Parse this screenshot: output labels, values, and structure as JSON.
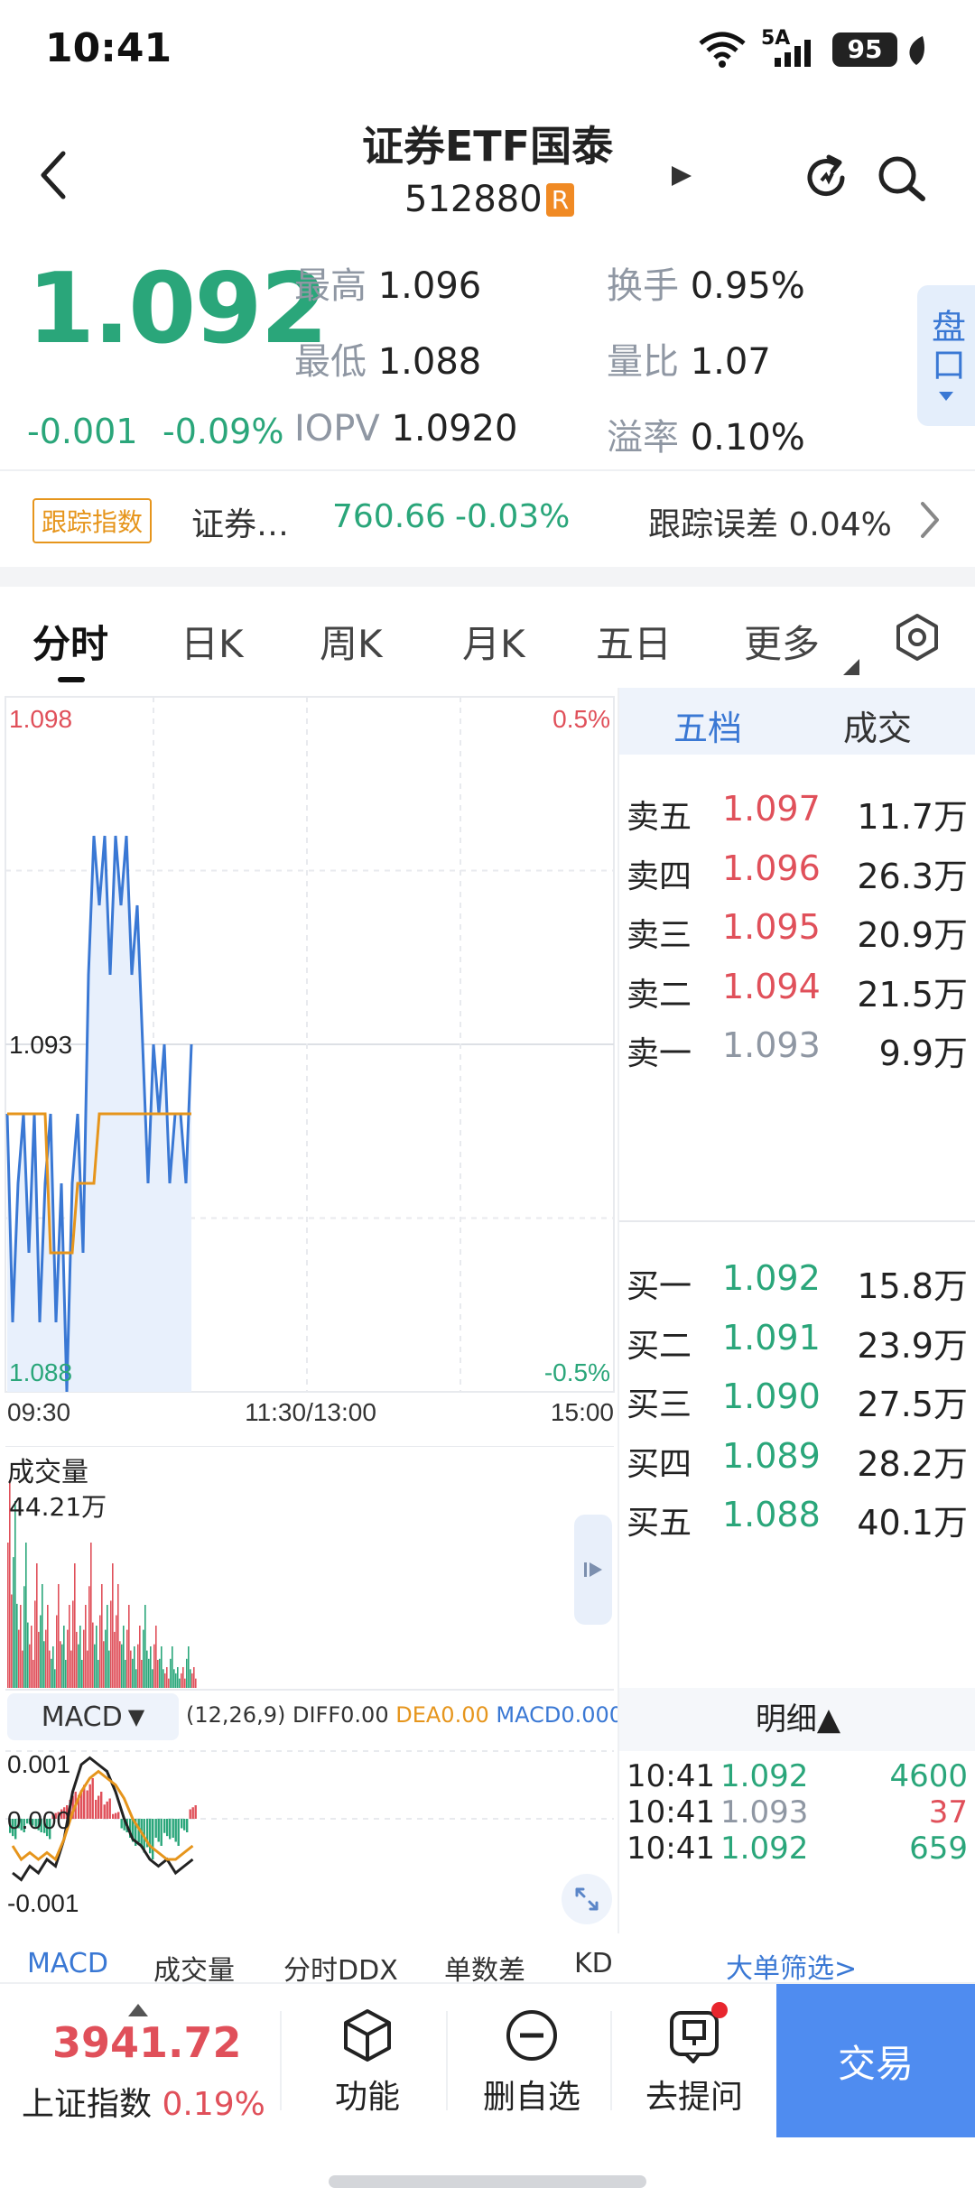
{
  "status_bar": {
    "time": "10:41",
    "net_label": "5A",
    "battery": "95"
  },
  "header": {
    "title": "证券ETF国泰",
    "code": "512880",
    "badge": "R"
  },
  "quote": {
    "price": "1.092",
    "change": "-0.001",
    "change_pct": "-0.09%",
    "high_label": "最高",
    "high": "1.096",
    "low_label": "最低",
    "low": "1.088",
    "iopv_label": "IOPV",
    "iopv": "1.0920",
    "turnover_label": "换手",
    "turnover": "0.95%",
    "vol_ratio_label": "量比",
    "vol_ratio": "1.07",
    "premium_label": "溢率",
    "premium": "0.10%",
    "pankou": "盘口"
  },
  "tracking": {
    "tag": "跟踪指数",
    "name": "证券…",
    "value": "760.66",
    "pct": "-0.03%",
    "error_label": "跟踪误差",
    "error": "0.04%"
  },
  "tabs": [
    {
      "label": "分时",
      "active": true
    },
    {
      "label": "日K",
      "active": false
    },
    {
      "label": "周K",
      "active": false
    },
    {
      "label": "月K",
      "active": false
    },
    {
      "label": "五日",
      "active": false
    },
    {
      "label": "更多",
      "active": false
    }
  ],
  "chart_data": {
    "type": "line",
    "y_max_label": "1.098",
    "y_mid_label": "1.093",
    "y_min_label": "1.088",
    "pct_max_label": "0.5%",
    "pct_min_label": "-0.5%",
    "x_labels": [
      "09:30",
      "11:30/13:00",
      "15:00"
    ],
    "ylim": [
      1.088,
      1.098
    ],
    "price": [
      1.092,
      1.089,
      1.091,
      1.092,
      1.09,
      1.092,
      1.089,
      1.091,
      1.092,
      1.089,
      1.091,
      1.088,
      1.091,
      1.092,
      1.09,
      1.094,
      1.096,
      1.095,
      1.096,
      1.094,
      1.096,
      1.095,
      1.096,
      1.094,
      1.095,
      1.093,
      1.091,
      1.093,
      1.092,
      1.093,
      1.091,
      1.092,
      1.092,
      1.091,
      1.093
    ],
    "avg": [
      1.092,
      1.092,
      1.092,
      1.092,
      1.092,
      1.092,
      1.092,
      1.092,
      1.09,
      1.09,
      1.09,
      1.09,
      1.09,
      1.091,
      1.091,
      1.091,
      1.091,
      1.092,
      1.092,
      1.092,
      1.092,
      1.092,
      1.092,
      1.092,
      1.092,
      1.092,
      1.092,
      1.092,
      1.092,
      1.092,
      1.092,
      1.092,
      1.092,
      1.092,
      1.092
    ],
    "volume_label": "成交量",
    "volume_max_label": "44.21万",
    "volume": [
      10,
      9,
      4,
      7,
      3,
      6,
      5,
      4,
      2,
      5,
      3,
      4,
      6,
      3,
      4,
      7,
      3,
      5,
      4,
      6,
      5,
      3,
      4,
      2,
      3,
      4,
      2,
      3,
      2,
      1,
      2,
      1,
      1,
      2,
      1
    ],
    "volume_up": [
      true,
      false,
      true,
      false,
      true,
      true,
      false,
      true,
      false,
      true,
      false,
      true,
      true,
      false,
      true,
      true,
      false,
      true,
      false,
      true,
      true,
      false,
      true,
      false,
      true,
      false,
      false,
      true,
      false,
      true,
      false,
      false,
      true,
      false,
      true
    ],
    "macd_title": "MACD",
    "macd_params": "(12,26,9)",
    "diff_label": "DIFF0.00",
    "dea_label": "DEA0.00",
    "macd_label": "MACD0.000",
    "macd_axis": [
      "0.001",
      "0.000",
      "-0.001"
    ],
    "macd_diff": [
      -0.0008,
      -0.0009,
      -0.0007,
      -0.0008,
      -0.0006,
      -0.0007,
      -0.0003,
      0.0004,
      0.0008,
      0.0009,
      0.0008,
      0.0007,
      0.0004,
      0.0,
      -0.0003,
      -0.0004,
      -0.0006,
      -0.0007,
      -0.0006,
      -0.0008,
      -0.0007,
      -0.0006
    ],
    "macd_dea": [
      -0.0004,
      -0.0006,
      -0.0005,
      -0.0006,
      -0.0005,
      -0.0006,
      -0.0003,
      0.0001,
      0.0004,
      0.0006,
      0.0007,
      0.0006,
      0.0005,
      0.0003,
      0.0,
      -0.0002,
      -0.0004,
      -0.0005,
      -0.0006,
      -0.0006,
      -0.0005,
      -0.0004
    ],
    "macd_hist": [
      -0.0003,
      -0.0002,
      -0.0001,
      -0.0002,
      -0.0003,
      0.0001,
      0.0002,
      0.0004,
      0.0005,
      0.0006,
      0.0004,
      0.0003,
      0.0001,
      -0.0002,
      -0.0004,
      -0.0005,
      -0.0006,
      -0.0004,
      -0.0003,
      -0.0004,
      -0.0002,
      0.0002
    ]
  },
  "orderbook": {
    "tab_a": "五档",
    "tab_b": "成交",
    "asks": [
      {
        "label": "卖五",
        "price": "1.097",
        "vol": "11.7万"
      },
      {
        "label": "卖四",
        "price": "1.096",
        "vol": "26.3万"
      },
      {
        "label": "卖三",
        "price": "1.095",
        "vol": "20.9万"
      },
      {
        "label": "卖二",
        "price": "1.094",
        "vol": "21.5万"
      },
      {
        "label": "卖一",
        "price": "1.093",
        "vol": "9.9万"
      }
    ],
    "bids": [
      {
        "label": "买一",
        "price": "1.092",
        "vol": "15.8万"
      },
      {
        "label": "买二",
        "price": "1.091",
        "vol": "23.9万"
      },
      {
        "label": "买三",
        "price": "1.090",
        "vol": "27.5万"
      },
      {
        "label": "买四",
        "price": "1.089",
        "vol": "28.2万"
      },
      {
        "label": "买五",
        "price": "1.088",
        "vol": "40.1万"
      }
    ],
    "detail_title": "明细▲",
    "details": [
      {
        "time": "10:41",
        "price": "1.092",
        "vol": "4600"
      },
      {
        "time": "10:41",
        "price": "1.093",
        "vol": "37"
      },
      {
        "time": "10:41",
        "price": "1.092",
        "vol": "659"
      }
    ],
    "filter_link": "大单筛选>"
  },
  "indicator_tabs": [
    "MACD",
    "成交量",
    "分时DDX",
    "单数差",
    "KD"
  ],
  "bottom_bar": {
    "index_value": "3941.72",
    "index_name": "上证指数",
    "index_pct": "0.19%",
    "btn_function": "功能",
    "btn_remove": "删自选",
    "btn_ask": "去提问",
    "btn_trade": "交易"
  },
  "colors": {
    "up": "#e0505a",
    "down": "#2aa67a",
    "price_line": "#3a78d4",
    "avg_line": "#e6951c",
    "accent": "#3a78d4"
  }
}
